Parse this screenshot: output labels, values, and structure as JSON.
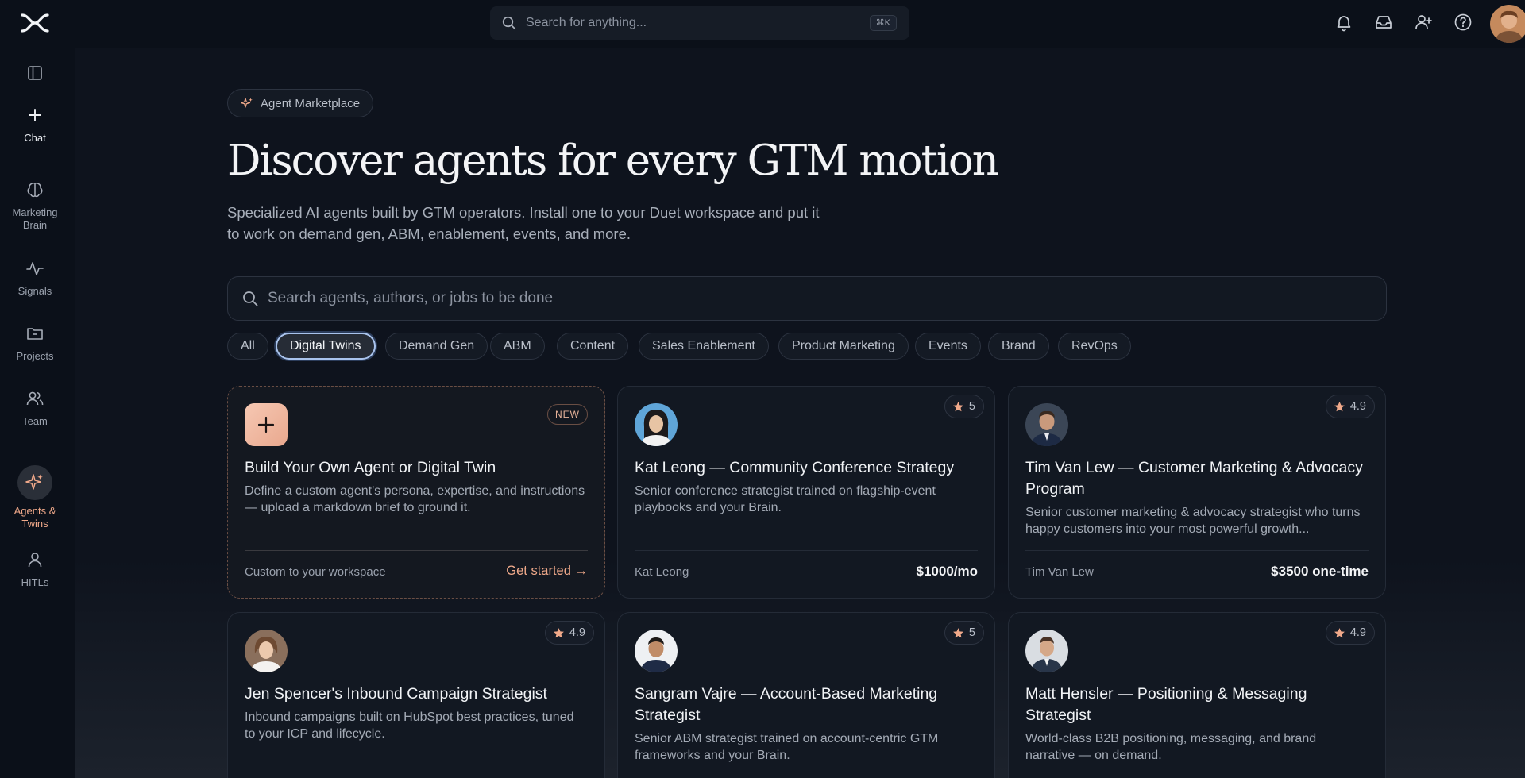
{
  "topbar": {
    "search_placeholder": "Search for anything...",
    "shortcut": "⌘K",
    "icons": [
      "bell-icon",
      "inbox-icon",
      "add-user-icon",
      "help-icon"
    ]
  },
  "sidebar": {
    "items": [
      {
        "label": "",
        "icon": "sidebar-toggle-icon"
      },
      {
        "label": "Chat",
        "icon": "plus-icon"
      },
      {
        "label": "Marketing Brain",
        "icon": "brain-icon"
      },
      {
        "label": "Signals",
        "icon": "pulse-icon"
      },
      {
        "label": "Projects",
        "icon": "folder-icon"
      },
      {
        "label": "Team",
        "icon": "users-icon"
      },
      {
        "label": "Agents & Twins",
        "icon": "sparkles-icon"
      },
      {
        "label": "HITLs",
        "icon": "person-icon"
      }
    ]
  },
  "hero": {
    "chip": "Agent Marketplace",
    "title": "Discover agents for every GTM motion",
    "subtitle": "Specialized AI agents built by GTM operators. Install one to your Duet workspace and put it to work on demand gen, ABM, enablement, events, and more."
  },
  "search": {
    "placeholder": "Search agents, authors, or jobs to be done"
  },
  "filters": [
    "All",
    "Digital Twins",
    "Demand Gen",
    "ABM",
    "Content",
    "Sales Enablement",
    "Product Marketing",
    "Events",
    "Brand",
    "RevOps"
  ],
  "selected_filter": "Digital Twins",
  "cards": [
    {
      "title": "Build Your Own Agent or Digital Twin",
      "desc": "Define a custom agent's persona, expertise, and instructions — upload a markdown brief to ground it.",
      "badge": "NEW",
      "footer_left": "Custom to your workspace",
      "cta": "Get started →"
    },
    {
      "title": "Kat Leong — Community Conference Strategy",
      "desc": "Senior conference strategist trained on flagship-event playbooks and your Brain.",
      "rating": "5",
      "author": "Kat Leong",
      "price": "$1000/mo"
    },
    {
      "title": "Tim Van Lew — Customer Marketing & Advocacy Program",
      "desc": "Senior customer marketing & advocacy strategist who turns happy customers into your most powerful growth...",
      "rating": "4.9",
      "author": "Tim Van Lew",
      "price": "$3500 one-time"
    },
    {
      "title": "Jen Spencer's Inbound Campaign Strategist",
      "desc": "Inbound campaigns built on HubSpot best practices, tuned to your ICP and lifecycle.",
      "rating": "4.9"
    },
    {
      "title": "Sangram Vajre — Account-Based Marketing Strategist",
      "desc": "Senior ABM strategist trained on account-centric GTM frameworks and your Brain.",
      "rating": "5"
    },
    {
      "title": "Matt Hensler — Positioning & Messaging Strategist",
      "desc": "World-class B2B positioning, messaging, and brand narrative — on demand.",
      "rating": "4.9"
    }
  ],
  "colors": {
    "accent": "#f0a98a",
    "background": "#0b1019",
    "card": "#121822",
    "selected_filter_border": "#a9c3ec"
  }
}
